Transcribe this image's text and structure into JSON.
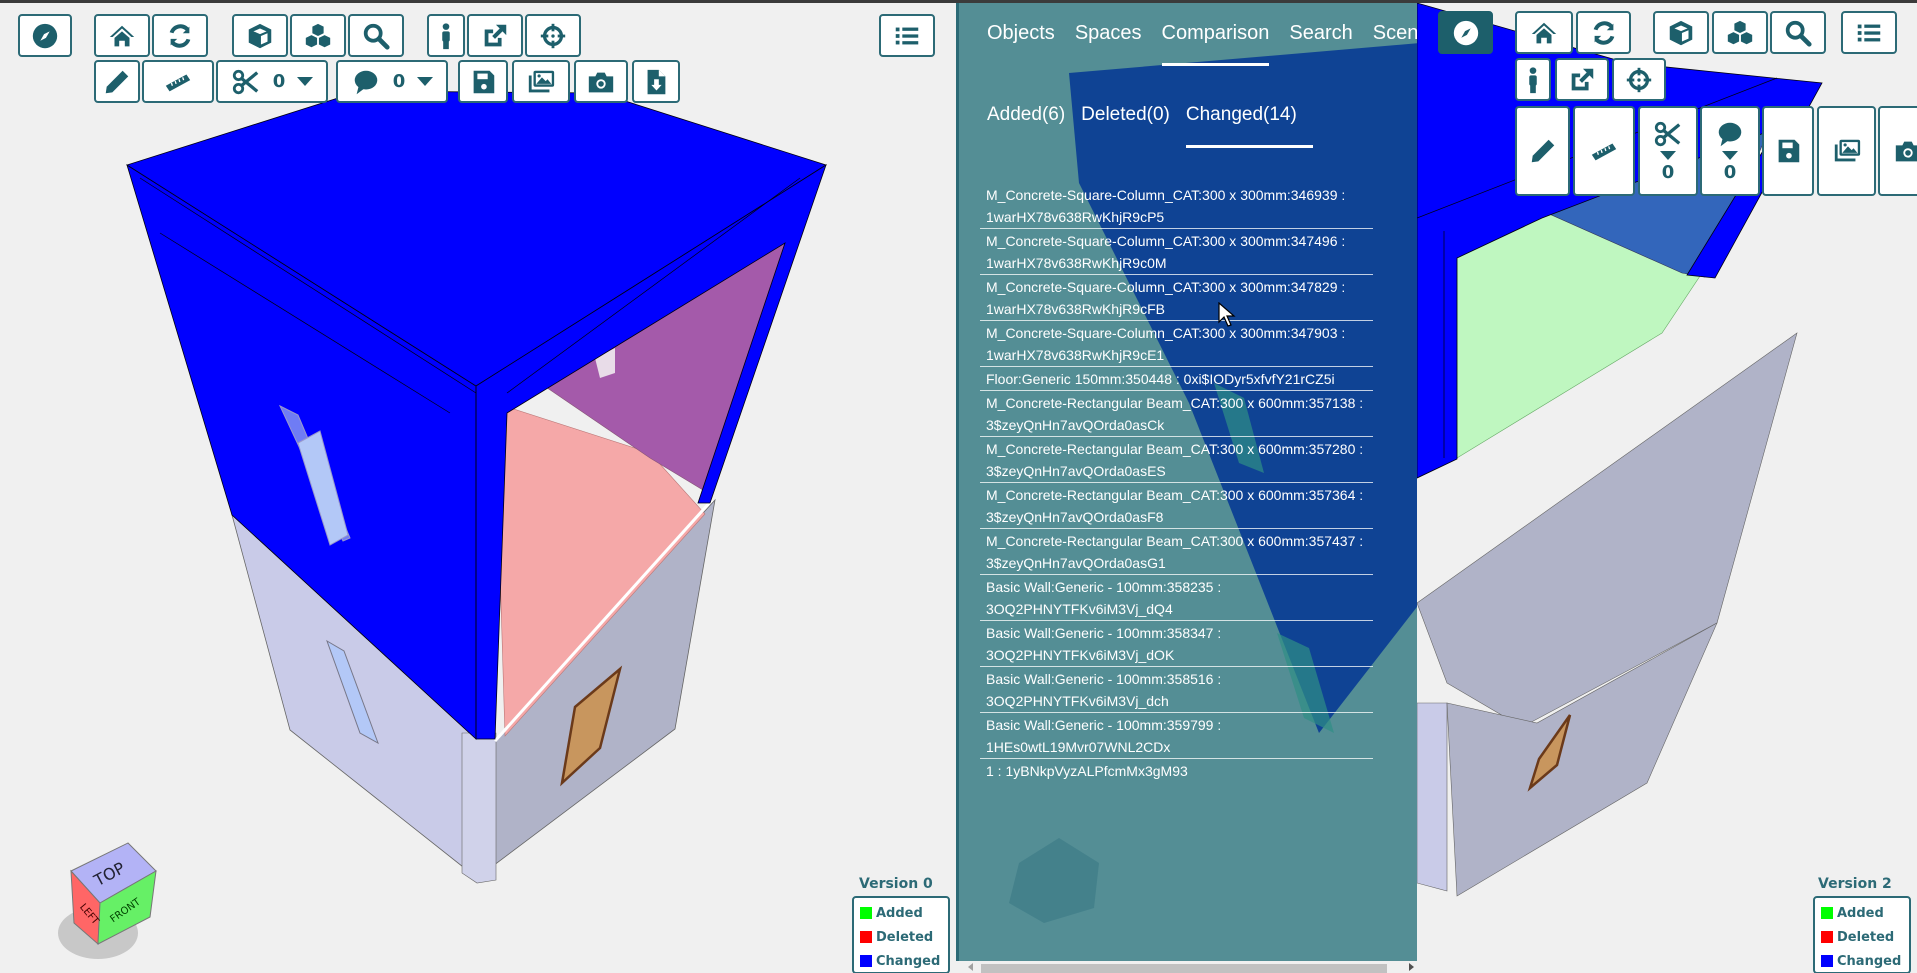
{
  "left_viewer": {
    "legend": {
      "title": "Version 0",
      "items": [
        {
          "label": "Added",
          "color": "#00ff00"
        },
        {
          "label": "Deleted",
          "color": "#ff0000"
        },
        {
          "label": "Changed",
          "color": "#0000ff"
        }
      ]
    },
    "toolbar": {
      "clip_count": "0",
      "comment_count": "0"
    },
    "navcube": {
      "top": "TOP",
      "left": "LEFT",
      "front": "FRONT"
    }
  },
  "right_viewer": {
    "legend": {
      "title": "Version 2",
      "items": [
        {
          "label": "Added",
          "color": "#00ff00"
        },
        {
          "label": "Deleted",
          "color": "#ff0000"
        },
        {
          "label": "Changed",
          "color": "#0000ff"
        }
      ]
    },
    "toolbar": {
      "clip_count": "0",
      "comment_count": "0"
    }
  },
  "panel": {
    "tabs": [
      {
        "label": "Objects",
        "active": false
      },
      {
        "label": "Spaces",
        "active": false
      },
      {
        "label": "Comparison",
        "active": true
      },
      {
        "label": "Search",
        "active": false
      },
      {
        "label": "Scenes",
        "active": false
      }
    ],
    "subtabs": [
      {
        "label": "Added(6)",
        "active": false
      },
      {
        "label": "Deleted(0)",
        "active": false
      },
      {
        "label": "Changed(14)",
        "active": true
      }
    ],
    "changed_items": [
      "M_Concrete-Square-Column_CAT:300 x 300mm:346939 : 1warHX78v638RwKhjR9cP5",
      "M_Concrete-Square-Column_CAT:300 x 300mm:347496 : 1warHX78v638RwKhjR9c0M",
      "M_Concrete-Square-Column_CAT:300 x 300mm:347829 : 1warHX78v638RwKhjR9cFB",
      "M_Concrete-Square-Column_CAT:300 x 300mm:347903 : 1warHX78v638RwKhjR9cE1",
      "Floor:Generic 150mm:350448 : 0xi$IODyr5xfvfY21rCZ5i",
      "M_Concrete-Rectangular Beam_CAT:300 x 600mm:357138 : 3$zeyQnHn7avQOrda0asCk",
      "M_Concrete-Rectangular Beam_CAT:300 x 600mm:357280 : 3$zeyQnHn7avQOrda0asES",
      "M_Concrete-Rectangular Beam_CAT:300 x 600mm:357364 : 3$zeyQnHn7avQOrda0asF8",
      "M_Concrete-Rectangular Beam_CAT:300 x 600mm:357437 : 3$zeyQnHn7avQOrda0asG1",
      "Basic Wall:Generic - 100mm:358235 : 3OQ2PHNYTFKv6iM3Vj_dQ4",
      "Basic Wall:Generic - 100mm:358347 : 3OQ2PHNYTFKv6iM3Vj_dOK",
      "Basic Wall:Generic - 100mm:358516 : 3OQ2PHNYTFKv6iM3Vj_dch",
      "Basic Wall:Generic - 100mm:359799 : 1HEs0wtL19Mvr07WNL2CDx",
      "1 : 1yBNkpVyzALPfcmMx3gM93"
    ]
  }
}
